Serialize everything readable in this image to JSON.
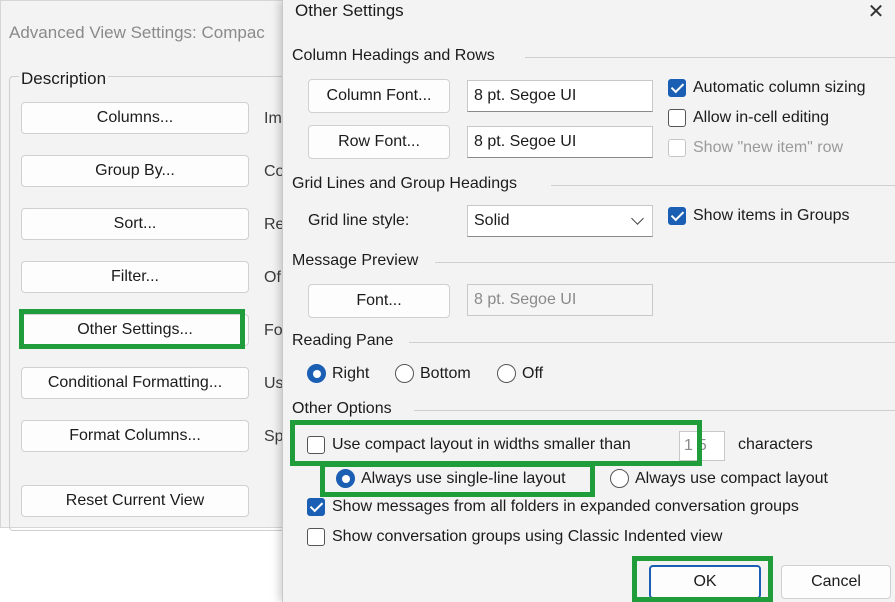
{
  "back_window": {
    "title": "Advanced View Settings: Compac",
    "description_label": "Description",
    "buttons": [
      {
        "label": "Columns...",
        "cut_label": "Im"
      },
      {
        "label": "Group By...",
        "cut_label": "Co"
      },
      {
        "label": "Sort...",
        "cut_label": "Re"
      },
      {
        "label": "Filter...",
        "cut_label": "Of"
      },
      {
        "label": "Other Settings...",
        "cut_label": "Fo"
      },
      {
        "label": "Conditional Formatting...",
        "cut_label": "Us"
      },
      {
        "label": "Format Columns...",
        "cut_label": "Sp"
      }
    ],
    "reset_label": "Reset Current View"
  },
  "dialog": {
    "title": "Other Settings",
    "close_glyph": "✕",
    "column_headings": {
      "heading": "Column Headings and Rows",
      "column_font_button": "Column Font...",
      "column_font_value": "8 pt. Segoe UI",
      "row_font_button": "Row Font...",
      "row_font_value": "8 pt. Segoe UI",
      "auto_sizing": {
        "label": "Automatic column sizing",
        "checked": true
      },
      "in_cell_editing": {
        "label": "Allow in-cell editing",
        "checked": false
      },
      "new_item_row": {
        "label": "Show \"new item\" row",
        "checked": false,
        "disabled": true
      }
    },
    "grid_lines": {
      "heading": "Grid Lines and Group Headings",
      "style_label": "Grid line style:",
      "style_value": "Solid",
      "show_in_groups": {
        "label": "Show items in Groups",
        "checked": true
      }
    },
    "message_preview": {
      "heading": "Message Preview",
      "font_button": "Font...",
      "font_value": "8 pt. Segoe UI"
    },
    "reading_pane": {
      "heading": "Reading Pane",
      "options": [
        {
          "label": "Right",
          "selected": true
        },
        {
          "label": "Bottom",
          "selected": false
        },
        {
          "label": "Off",
          "selected": false
        }
      ]
    },
    "other_options": {
      "heading": "Other Options",
      "compact_layout": {
        "label": "Use compact layout in widths smaller than",
        "checked": false
      },
      "compact_width_value": "15",
      "characters_label": "characters",
      "single_line": {
        "label": "Always use single-line layout",
        "selected": true
      },
      "compact_always": {
        "label": "Always use compact layout",
        "selected": false
      },
      "show_all_folders": {
        "label": "Show messages from all folders in expanded conversation groups",
        "checked": true
      },
      "classic_indented": {
        "label": "Show conversation groups using Classic Indented view",
        "checked": false
      }
    },
    "ok_label": "OK",
    "cancel_label": "Cancel"
  },
  "colors": {
    "highlight": "#1f9d3b",
    "accent": "#1a5fb4"
  }
}
